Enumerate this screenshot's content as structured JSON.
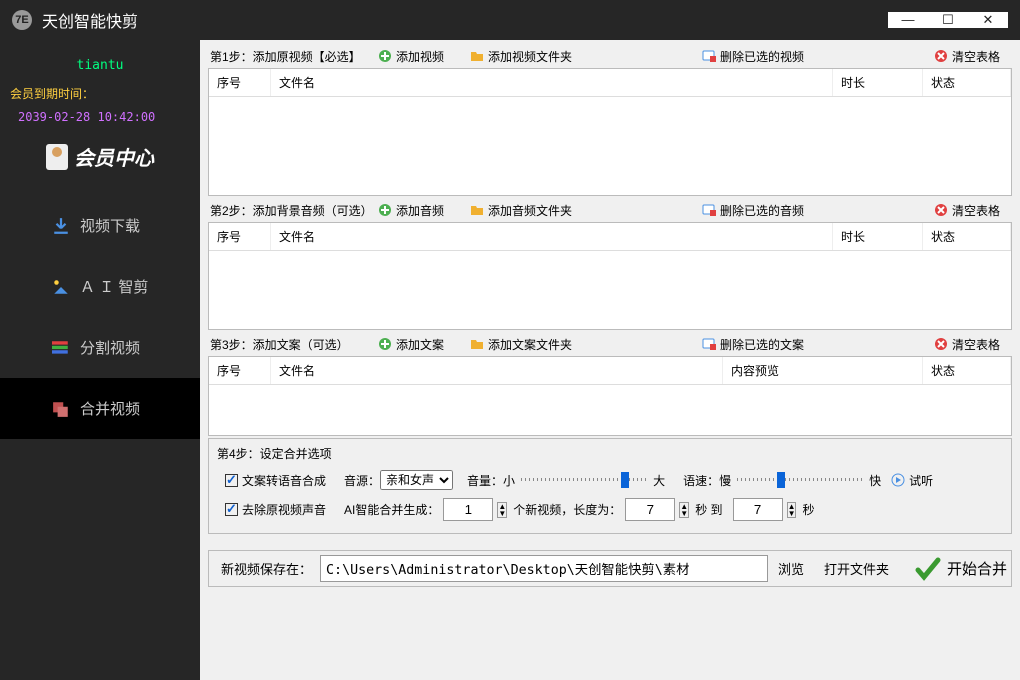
{
  "title": "天创智能快剪",
  "user": "tiantu",
  "expire_label": "会员到期时间：",
  "expire_time": "2039-02-28 10:42:00",
  "member_center": "会员中心",
  "nav": [
    {
      "label": "视频下载"
    },
    {
      "label": "Ａ Ｉ 智剪"
    },
    {
      "label": "分割视频"
    },
    {
      "label": "合并视频"
    }
  ],
  "steps": {
    "s1": {
      "title": "第1步：添加原视频【必选】",
      "add": "添加视频",
      "addFolder": "添加视频文件夹",
      "del": "删除已选的视频",
      "clear": "清空表格",
      "cols": {
        "idx": "序号",
        "name": "文件名",
        "dur": "时长",
        "st": "状态"
      }
    },
    "s2": {
      "title": "第2步：添加背景音频（可选）",
      "add": "添加音频",
      "addFolder": "添加音频文件夹",
      "del": "删除已选的音频",
      "clear": "清空表格",
      "cols": {
        "idx": "序号",
        "name": "文件名",
        "dur": "时长",
        "st": "状态"
      }
    },
    "s3": {
      "title": "第3步：添加文案（可选）",
      "add": "添加文案",
      "addFolder": "添加文案文件夹",
      "del": "删除已选的文案",
      "clear": "清空表格",
      "cols": {
        "idx": "序号",
        "name": "文件名",
        "prev": "内容预览",
        "st": "状态"
      }
    }
  },
  "s4": {
    "title": "第4步：设定合并选项",
    "tts": "文案转语音合成",
    "voice_lbl": "音源：",
    "voice_val": "亲和女声",
    "vol_lbl": "音量：",
    "vol_small": "小",
    "vol_big": "大",
    "speed_lbl": "语速：",
    "speed_slow": "慢",
    "speed_fast": "快",
    "preview": "试听",
    "remove_orig": "去除原视频声音",
    "ai_gen": "AI智能合并生成：",
    "count": "1",
    "count_suf": "个新视频，长度为：",
    "len_from": "7",
    "len_to_lbl": "秒 到",
    "len_to": "7",
    "len_suf": "秒",
    "save_lbl": "新视频保存在：",
    "save_path": "C:\\Users\\Administrator\\Desktop\\天创智能快剪\\素材",
    "browse": "浏览",
    "open_folder": "打开文件夹",
    "start": "开始合并"
  }
}
